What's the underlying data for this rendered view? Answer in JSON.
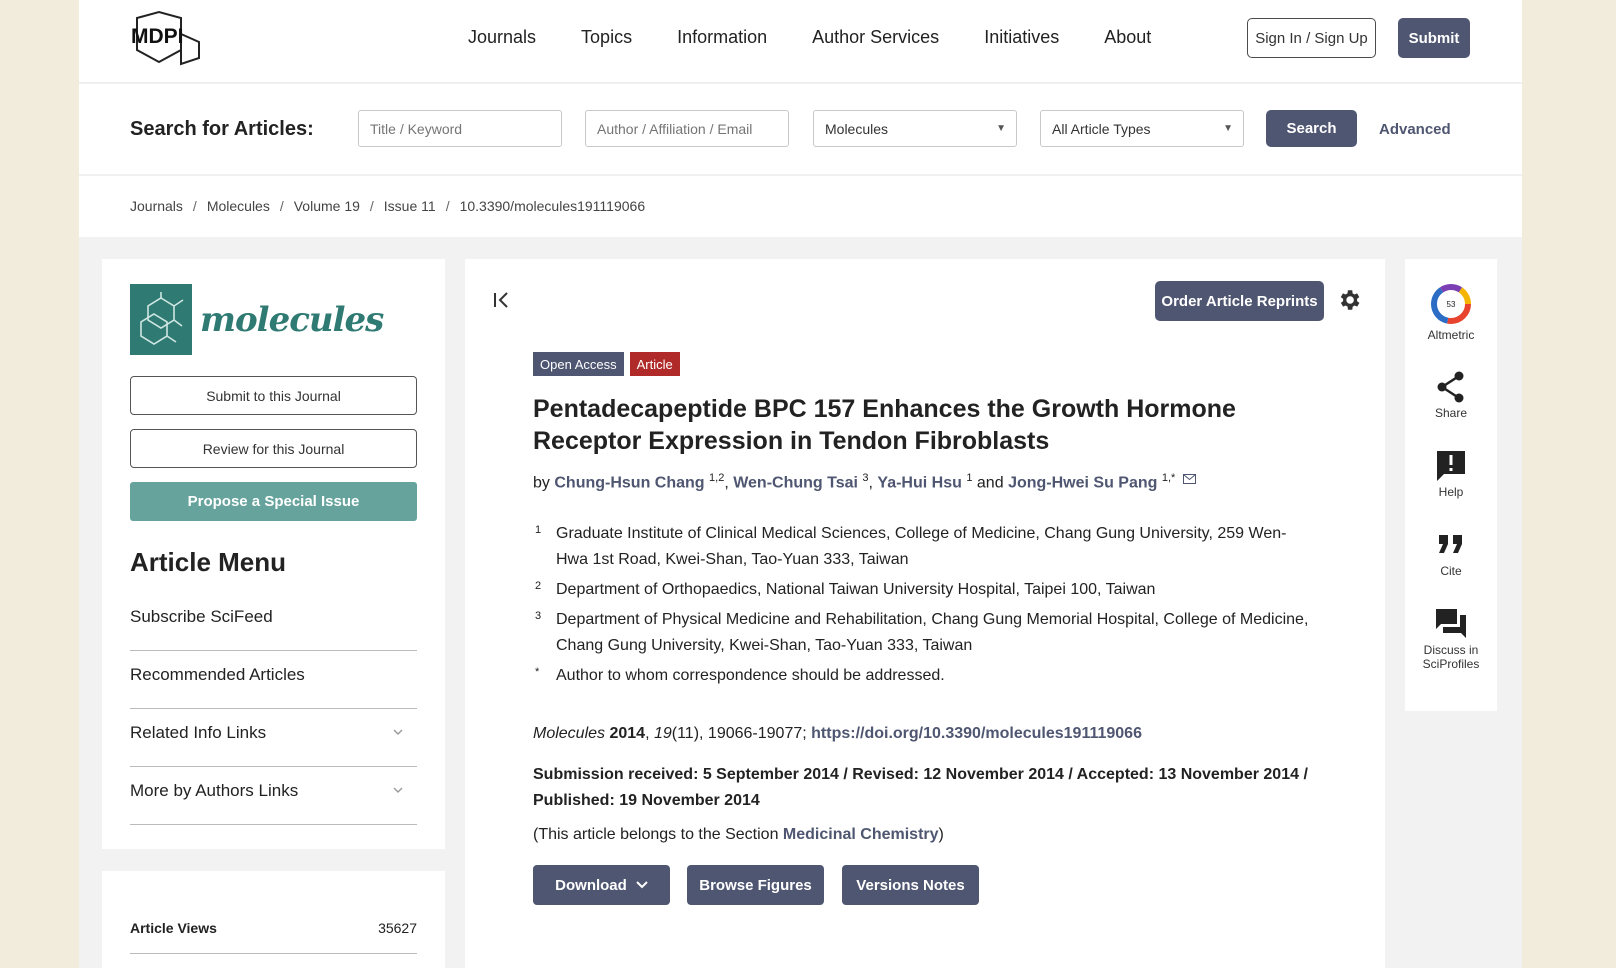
{
  "header": {
    "logo_text": "MDPI",
    "nav": [
      "Journals",
      "Topics",
      "Information",
      "Author Services",
      "Initiatives",
      "About"
    ],
    "signin_label": "Sign In / Sign Up",
    "submit_label": "Submit"
  },
  "search": {
    "label": "Search for Articles:",
    "title_placeholder": "Title / Keyword",
    "author_placeholder": "Author / Affiliation / Email",
    "journal_value": "Molecules",
    "type_value": "All Article Types",
    "search_label": "Search",
    "advanced_label": "Advanced"
  },
  "breadcrumb": [
    "Journals",
    "Molecules",
    "Volume 19",
    "Issue 11",
    "10.3390/molecules191119066"
  ],
  "sidebar": {
    "journal_name": "molecules",
    "submit_label": "Submit to this Journal",
    "review_label": "Review for this Journal",
    "propose_label": "Propose a Special Issue",
    "menu_title": "Article Menu",
    "menu_items": [
      "Subscribe SciFeed",
      "Recommended Articles",
      "Related Info Links",
      "More by Authors Links"
    ],
    "views_label": "Article Views",
    "views_value": "35627"
  },
  "article": {
    "reprints_label": "Order Article Reprints",
    "badge_open": "Open Access",
    "badge_type": "Article",
    "title": "Pentadecapeptide BPC 157 Enhances the Growth Hormone Receptor Expression in Tendon Fibroblasts",
    "by": "by",
    "authors": [
      {
        "name": "Chung-Hsun Chang",
        "sup": "1,2"
      },
      {
        "name": "Wen-Chung Tsai",
        "sup": "3"
      },
      {
        "name": "Ya-Hui Hsu",
        "sup": "1"
      },
      {
        "name": "Jong-Hwei Su Pang",
        "sup": "1,*"
      }
    ],
    "and": "and",
    "affiliations": [
      {
        "n": "1",
        "text": "Graduate Institute of Clinical Medical Sciences, College of Medicine, Chang Gung University, 259 Wen-Hwa 1st Road, Kwei-Shan, Tao-Yuan 333, Taiwan"
      },
      {
        "n": "2",
        "text": "Department of Orthopaedics, National Taiwan University Hospital, Taipei 100, Taiwan"
      },
      {
        "n": "3",
        "text": "Department of Physical Medicine and Rehabilitation, Chang Gung Memorial Hospital, College of Medicine, Chang Gung University, Kwei-Shan, Tao-Yuan 333, Taiwan"
      },
      {
        "n": "*",
        "text": "Author to whom correspondence should be addressed."
      }
    ],
    "cite_journal": "Molecules",
    "cite_year": "2014",
    "cite_volume": "19",
    "cite_rest": "(11), 19066-19077;",
    "doi_link": "https://doi.org/10.3390/molecules191119066",
    "dates": "Submission received: 5 September 2014 / Revised: 12 November 2014 / Accepted: 13 November 2014 / Published: 19 November 2014",
    "section_prefix": "(This article belongs to the Section",
    "section_name": "Medicinal Chemistry",
    "section_suffix": ")",
    "download_label": "Download",
    "figures_label": "Browse Figures",
    "versions_label": "Versions Notes"
  },
  "rail": {
    "altmetric_score": "53",
    "altmetric_label": "Altmetric",
    "share_label": "Share",
    "help_label": "Help",
    "cite_label": "Cite",
    "discuss_line1": "Discuss in",
    "discuss_line2": "SciProfiles"
  },
  "colors": {
    "brand": "#4f5671",
    "teal": "#2f7a72",
    "article_red": "#b02a2a"
  }
}
